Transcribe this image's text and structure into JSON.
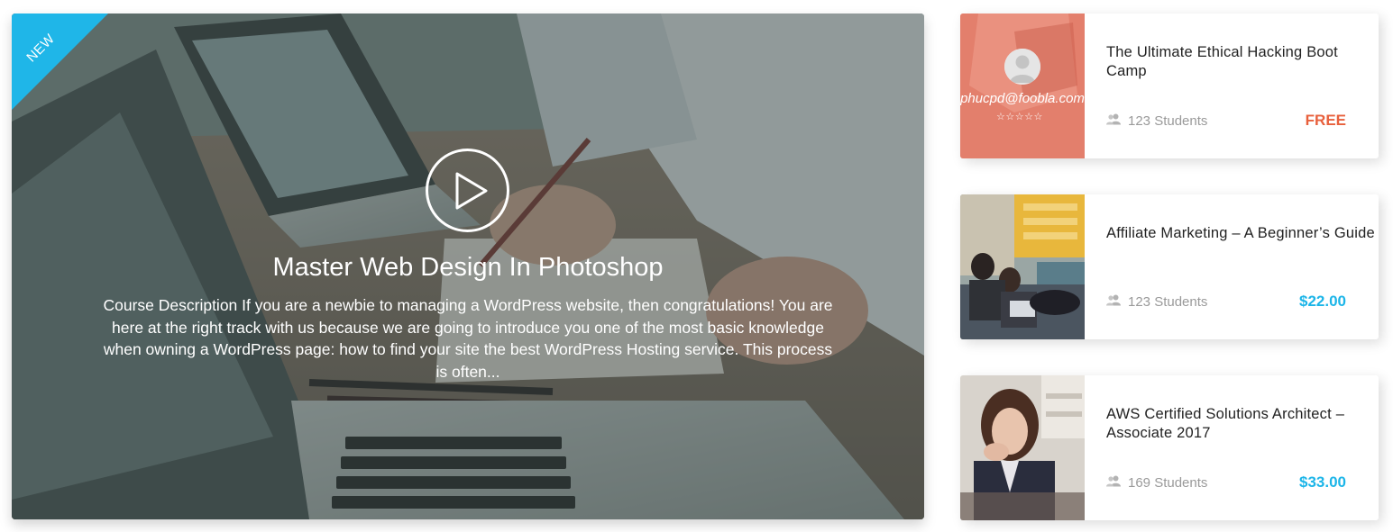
{
  "featured": {
    "badge": "NEW",
    "title": "Master Web Design In Photoshop",
    "description": "Course Description If you are a newbie to managing a WordPress website, then congratulations! You are here at the right track with us because we are going to introduce you one of the most basic knowledge when owning a WordPress page: how to find your site the best WordPress Hosting service. This process is often...",
    "play_icon": "play-circle-icon",
    "badge_color": "#1fb6e8"
  },
  "courses": [
    {
      "title": "The Ultimate Ethical Hacking Boot Camp",
      "students": "123 Students",
      "price": "FREE",
      "author_email": "phucpd@foobla.com",
      "rating_stars": "☆☆☆☆☆",
      "students_icon": "users-icon",
      "price_color": "#e8603c"
    },
    {
      "title": "Affiliate Marketing – A Beginner’s Guide",
      "students": "123 Students",
      "price": "$22.00",
      "students_icon": "users-icon",
      "price_color": "#1cb5e8"
    },
    {
      "title": "AWS Certified Solutions Architect – Associate 2017",
      "students": "169 Students",
      "price": "$33.00",
      "students_icon": "users-icon",
      "price_color": "#1cb5e8"
    }
  ]
}
